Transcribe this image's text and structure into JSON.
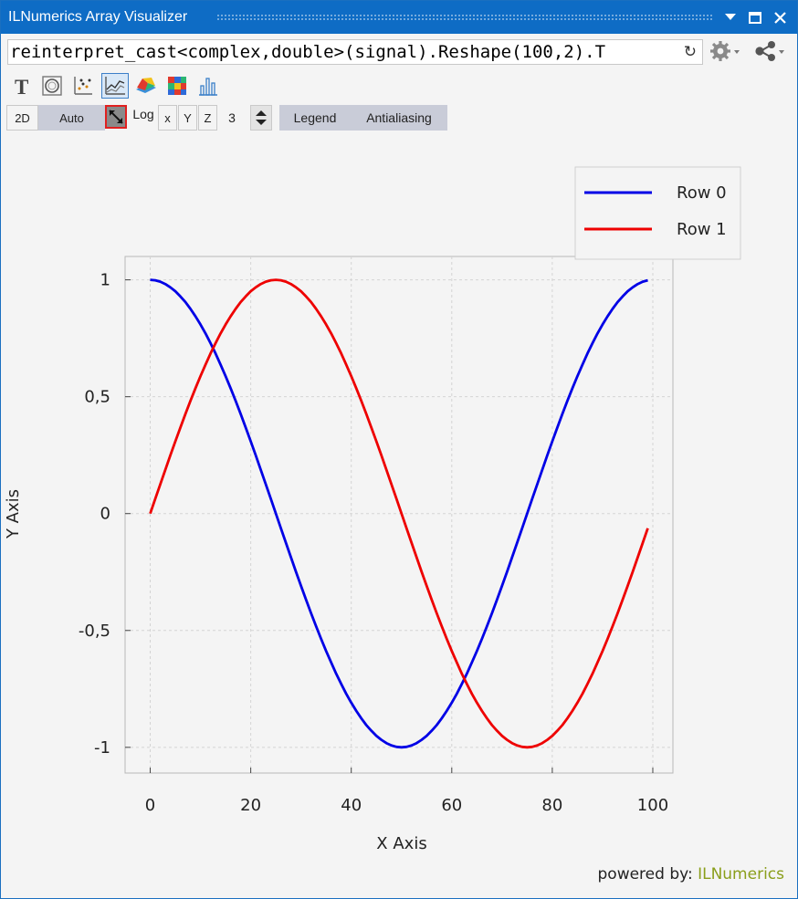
{
  "window": {
    "title": "ILNumerics Array Visualizer"
  },
  "titlebar_buttons": {
    "dropdown_icon": "dropdown-arrow-icon",
    "maximize_icon": "maximize-icon",
    "close_icon": "close-icon"
  },
  "expression": {
    "value": "reinterpret_cast<complex,double>(signal).Reshape(100,2).T"
  },
  "toolbar": {
    "plot_types": [
      "text-view-icon",
      "surface-view-icon",
      "scatter-plot-icon",
      "line-plot-icon",
      "surface-3d-icon",
      "image-plot-icon",
      "bar-plot-icon"
    ],
    "active_plot_type": "line-plot-icon",
    "mode_2d": "2D",
    "auto": "Auto",
    "log": "Log",
    "axis_x": "x",
    "axis_y": "Y",
    "axis_z": "Z",
    "dim_value": "3",
    "legend": "Legend",
    "antialiasing": "Antialiasing"
  },
  "colors": {
    "titlebar": "#0e6cc5",
    "row0": "#0000e6",
    "row1": "#ee0000",
    "brand": "#8a9e1a"
  },
  "chart_data": {
    "type": "line",
    "xlabel": "X Axis",
    "ylabel": "Y Axis",
    "xlim": [
      -5,
      104
    ],
    "ylim": [
      -1.11,
      1.1
    ],
    "x_ticks": [
      0,
      20,
      40,
      60,
      80,
      100
    ],
    "x_tick_labels": [
      "0",
      "20",
      "40",
      "60",
      "80",
      "100"
    ],
    "y_ticks": [
      1,
      0.5,
      0,
      -0.5,
      -1
    ],
    "y_tick_labels": [
      "1",
      "0,5",
      "0",
      "-0,5",
      "-1"
    ],
    "grid": true,
    "legend_position": "top-right",
    "x": [
      0,
      1,
      2,
      3,
      4,
      5,
      6,
      7,
      8,
      9,
      10,
      11,
      12,
      13,
      14,
      15,
      16,
      17,
      18,
      19,
      20,
      21,
      22,
      23,
      24,
      25,
      26,
      27,
      28,
      29,
      30,
      31,
      32,
      33,
      34,
      35,
      36,
      37,
      38,
      39,
      40,
      41,
      42,
      43,
      44,
      45,
      46,
      47,
      48,
      49,
      50,
      51,
      52,
      53,
      54,
      55,
      56,
      57,
      58,
      59,
      60,
      61,
      62,
      63,
      64,
      65,
      66,
      67,
      68,
      69,
      70,
      71,
      72,
      73,
      74,
      75,
      76,
      77,
      78,
      79,
      80,
      81,
      82,
      83,
      84,
      85,
      86,
      87,
      88,
      89,
      90,
      91,
      92,
      93,
      94,
      95,
      96,
      97,
      98,
      99
    ],
    "series": [
      {
        "name": "Row 0",
        "values": [
          1.0,
          0.998,
          0.992,
          0.982,
          0.968,
          0.951,
          0.929,
          0.905,
          0.876,
          0.844,
          0.809,
          0.771,
          0.729,
          0.685,
          0.637,
          0.588,
          0.536,
          0.482,
          0.426,
          0.368,
          0.309,
          0.249,
          0.187,
          0.125,
          0.063,
          0.0,
          -0.063,
          -0.125,
          -0.187,
          -0.249,
          -0.309,
          -0.368,
          -0.426,
          -0.482,
          -0.536,
          -0.588,
          -0.637,
          -0.685,
          -0.729,
          -0.771,
          -0.809,
          -0.844,
          -0.876,
          -0.905,
          -0.929,
          -0.951,
          -0.968,
          -0.982,
          -0.992,
          -0.998,
          -1.0,
          -0.998,
          -0.992,
          -0.982,
          -0.968,
          -0.951,
          -0.929,
          -0.905,
          -0.876,
          -0.844,
          -0.809,
          -0.771,
          -0.729,
          -0.685,
          -0.637,
          -0.588,
          -0.536,
          -0.482,
          -0.426,
          -0.368,
          -0.309,
          -0.249,
          -0.187,
          -0.125,
          -0.063,
          0.0,
          0.063,
          0.125,
          0.187,
          0.249,
          0.309,
          0.368,
          0.426,
          0.482,
          0.536,
          0.588,
          0.637,
          0.685,
          0.729,
          0.771,
          0.809,
          0.844,
          0.876,
          0.905,
          0.929,
          0.951,
          0.968,
          0.982,
          0.992,
          0.998
        ]
      },
      {
        "name": "Row 1",
        "values": [
          0.0,
          0.063,
          0.125,
          0.187,
          0.249,
          0.309,
          0.368,
          0.426,
          0.482,
          0.536,
          0.588,
          0.637,
          0.685,
          0.729,
          0.771,
          0.809,
          0.844,
          0.876,
          0.905,
          0.929,
          0.951,
          0.968,
          0.982,
          0.992,
          0.998,
          1.0,
          0.998,
          0.992,
          0.982,
          0.968,
          0.951,
          0.929,
          0.905,
          0.876,
          0.844,
          0.809,
          0.771,
          0.729,
          0.685,
          0.637,
          0.588,
          0.536,
          0.482,
          0.426,
          0.368,
          0.309,
          0.249,
          0.187,
          0.125,
          0.063,
          0.0,
          -0.063,
          -0.125,
          -0.187,
          -0.249,
          -0.309,
          -0.368,
          -0.426,
          -0.482,
          -0.536,
          -0.588,
          -0.637,
          -0.685,
          -0.729,
          -0.771,
          -0.809,
          -0.844,
          -0.876,
          -0.905,
          -0.929,
          -0.951,
          -0.968,
          -0.982,
          -0.992,
          -0.998,
          -1.0,
          -0.998,
          -0.992,
          -0.982,
          -0.968,
          -0.951,
          -0.929,
          -0.905,
          -0.876,
          -0.844,
          -0.809,
          -0.771,
          -0.729,
          -0.685,
          -0.637,
          -0.588,
          -0.536,
          -0.482,
          -0.426,
          -0.368,
          -0.309,
          -0.249,
          -0.187,
          -0.125,
          -0.063
        ]
      }
    ]
  },
  "footer": {
    "powered_by": "powered by:",
    "brand": "ILNumerics"
  }
}
